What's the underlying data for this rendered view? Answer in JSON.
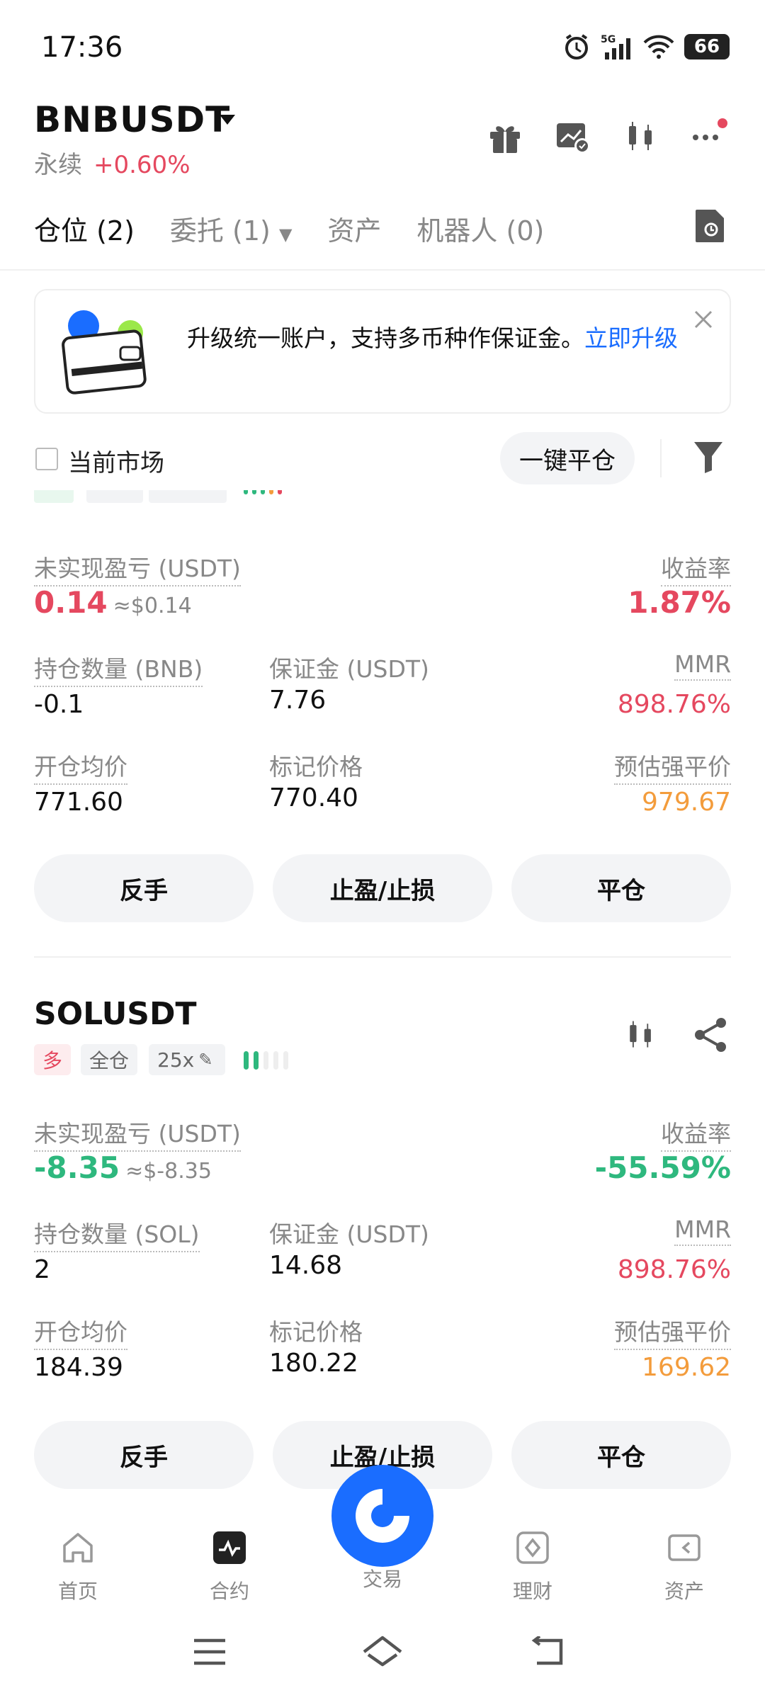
{
  "status_bar": {
    "time": "17:36",
    "network": "5G",
    "battery": "66"
  },
  "header": {
    "symbol": "BNBUSDT",
    "type": "永续",
    "change": "+0.60%"
  },
  "tabs": [
    {
      "label": "仓位 (2)"
    },
    {
      "label": "委托 (1)"
    },
    {
      "label": "资产"
    },
    {
      "label": "机器人 (0)"
    }
  ],
  "banner": {
    "text": "升级统一账户，支持多币种作保证金。",
    "link": "立即升级"
  },
  "filter": {
    "checkbox_label": "当前市场",
    "close_all": "一键平仓"
  },
  "positions": [
    {
      "pnl_label": "未实现盈亏 (USDT)",
      "pnl": "0.14",
      "pnl_approx": "≈$0.14",
      "roe_label": "收益率",
      "roe": "1.87%",
      "qty_label": "持仓数量 (BNB)",
      "qty": "-0.1",
      "margin_label": "保证金 (USDT)",
      "margin": "7.76",
      "mmr_label": "MMR",
      "mmr": "898.76%",
      "entry_label": "开仓均价",
      "entry": "771.60",
      "mark_label": "标记价格",
      "mark": "770.40",
      "liq_label": "预估强平价",
      "liq": "979.67",
      "actions": [
        "反手",
        "止盈/止损",
        "平仓"
      ]
    },
    {
      "pair": "SOLUSDT",
      "tags": {
        "side": "多",
        "mode": "全仓",
        "leverage": "25x"
      },
      "pnl_label": "未实现盈亏 (USDT)",
      "pnl": "-8.35",
      "pnl_approx": "≈$-8.35",
      "roe_label": "收益率",
      "roe": "-55.59%",
      "qty_label": "持仓数量 (SOL)",
      "qty": "2",
      "margin_label": "保证金 (USDT)",
      "margin": "14.68",
      "mmr_label": "MMR",
      "mmr": "898.76%",
      "entry_label": "开仓均价",
      "entry": "184.39",
      "mark_label": "标记价格",
      "mark": "180.22",
      "liq_label": "预估强平价",
      "liq": "169.62",
      "actions": [
        "反手",
        "止盈/止损",
        "平仓"
      ]
    }
  ],
  "bottom_nav": [
    {
      "label": "首页",
      "icon": "home-icon"
    },
    {
      "label": "合约",
      "icon": "futures-icon"
    },
    {
      "label": "交易",
      "icon": "trade-icon"
    },
    {
      "label": "理财",
      "icon": "earn-icon"
    },
    {
      "label": "资产",
      "icon": "wallet-icon"
    }
  ],
  "colors": {
    "positive": "#e5485f",
    "negative": "#2eb87e",
    "liquidation": "#f39c3c",
    "accent": "#1a6dff"
  }
}
